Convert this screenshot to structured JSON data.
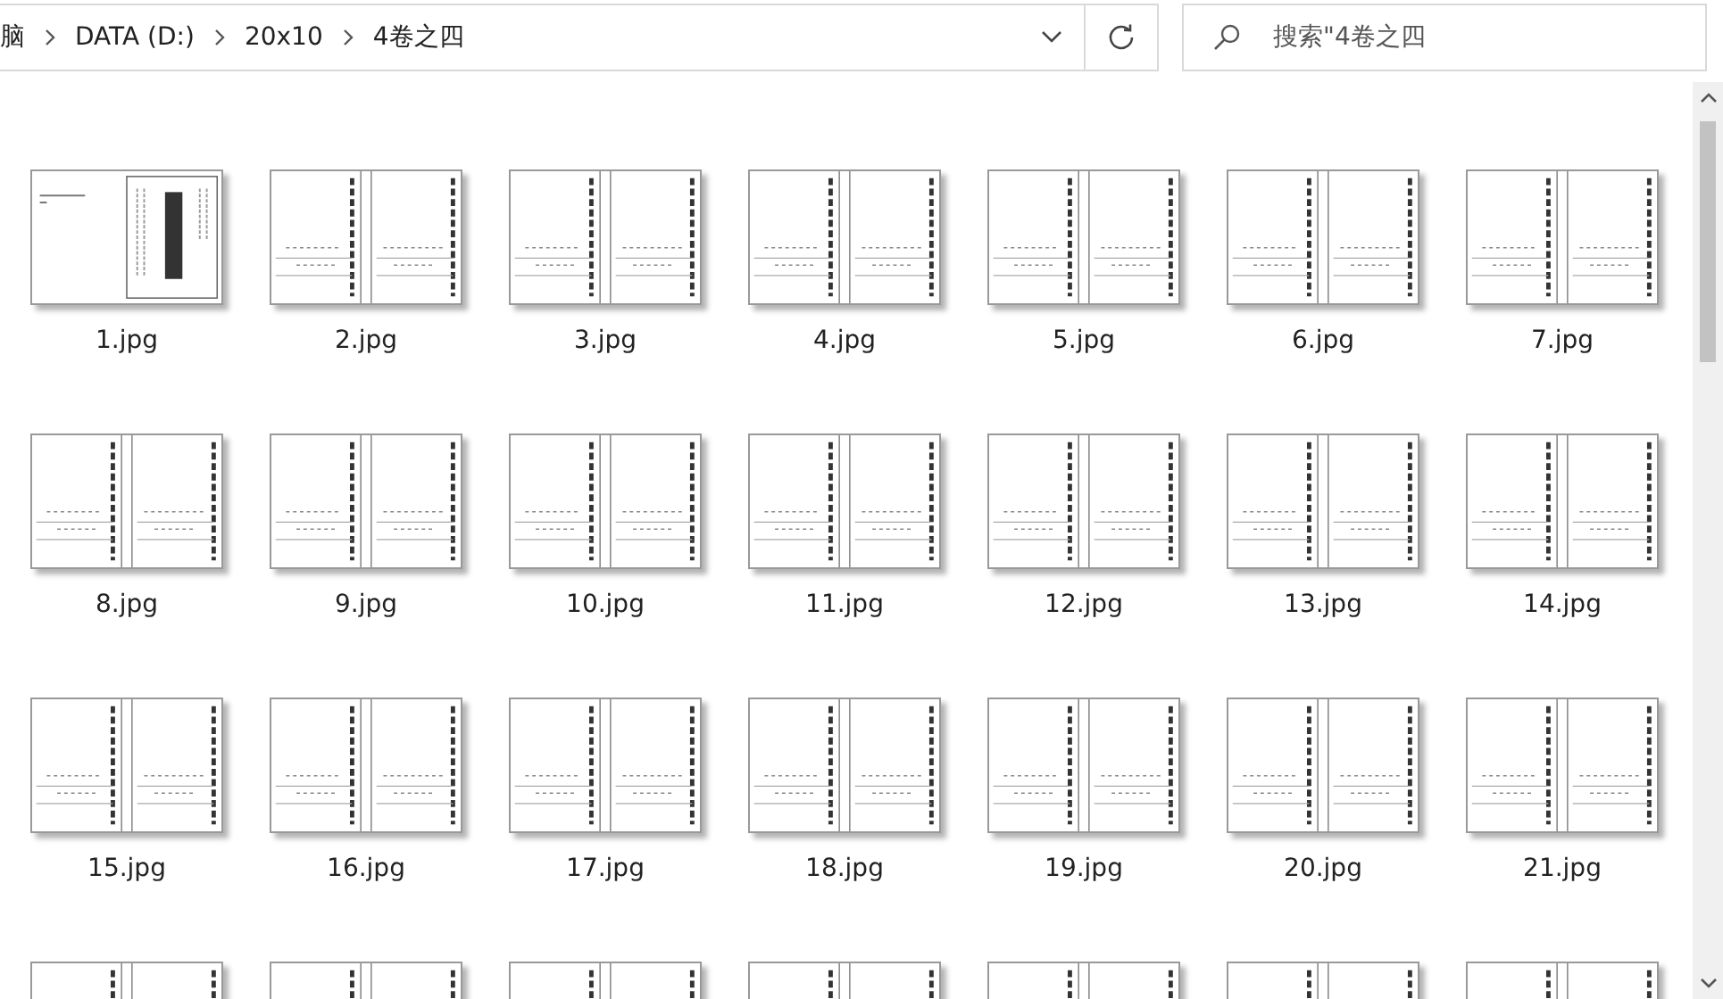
{
  "address_bar": {
    "path": [
      {
        "label": "脑"
      },
      {
        "label": "DATA (D:)"
      },
      {
        "label": "20x10"
      },
      {
        "label": "4卷之四"
      }
    ]
  },
  "search": {
    "placeholder": "搜索\"4卷之四"
  },
  "files": [
    {
      "name": "1.jpg",
      "kind": "cover"
    },
    {
      "name": "2.jpg",
      "kind": "spread"
    },
    {
      "name": "3.jpg",
      "kind": "spread"
    },
    {
      "name": "4.jpg",
      "kind": "spread"
    },
    {
      "name": "5.jpg",
      "kind": "spread"
    },
    {
      "name": "6.jpg",
      "kind": "spread"
    },
    {
      "name": "7.jpg",
      "kind": "spread"
    },
    {
      "name": "8.jpg",
      "kind": "spread"
    },
    {
      "name": "9.jpg",
      "kind": "spread"
    },
    {
      "name": "10.jpg",
      "kind": "spread"
    },
    {
      "name": "11.jpg",
      "kind": "spread"
    },
    {
      "name": "12.jpg",
      "kind": "spread"
    },
    {
      "name": "13.jpg",
      "kind": "spread"
    },
    {
      "name": "14.jpg",
      "kind": "spread"
    },
    {
      "name": "15.jpg",
      "kind": "spread"
    },
    {
      "name": "16.jpg",
      "kind": "spread"
    },
    {
      "name": "17.jpg",
      "kind": "spread"
    },
    {
      "name": "18.jpg",
      "kind": "spread"
    },
    {
      "name": "19.jpg",
      "kind": "spread"
    },
    {
      "name": "20.jpg",
      "kind": "spread"
    },
    {
      "name": "21.jpg",
      "kind": "spread"
    },
    {
      "kind": "spread"
    },
    {
      "kind": "spread"
    },
    {
      "kind": "spread"
    },
    {
      "kind": "spread"
    },
    {
      "kind": "spread"
    },
    {
      "kind": "spread"
    },
    {
      "kind": "spread"
    }
  ]
}
